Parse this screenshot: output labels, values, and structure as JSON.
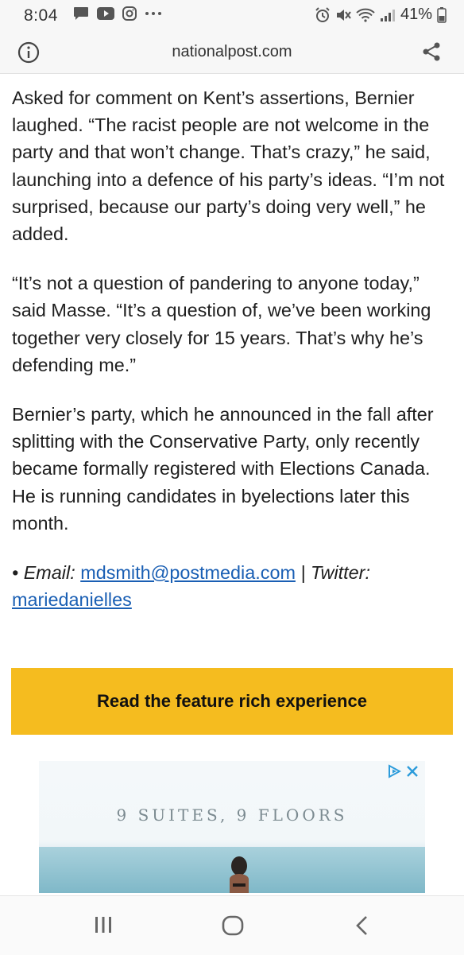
{
  "status_bar": {
    "time": "8:04",
    "battery": "41%"
  },
  "url_bar": {
    "url": "nationalpost.com"
  },
  "article": {
    "paragraphs": [
      "Asked for comment on Kent’s assertions, Bernier laughed. “The racist people are not welcome in the party and that won’t change. That’s crazy,” he said, launching into a defence of his party’s ideas. “I’m not surprised, because our party’s doing very well,” he added.",
      "“It’s not a question of pandering to anyone today,” said Masse. “It’s a question of, we’ve been working together very closely for 15 years. That’s why he’s defending me.”",
      "Bernier’s party, which he announced in the fall after splitting with the Conservative Party, only recently became formally registered with Elections Canada. He is running candidates in byelections later this month."
    ],
    "contact": {
      "bullet": "• ",
      "email_label": "Email: ",
      "email": "mdsmith@postmedia.com",
      "separator": " | Twitter: ",
      "twitter": "mariedanielles"
    }
  },
  "cta": {
    "label": "Read the feature rich experience"
  },
  "ad": {
    "headline": "9 SUITES, 9 FLOORS"
  },
  "colors": {
    "cta_background": "#f5bc1f",
    "link": "#1a5fb4",
    "ad_choices": "#2d9cdb"
  }
}
